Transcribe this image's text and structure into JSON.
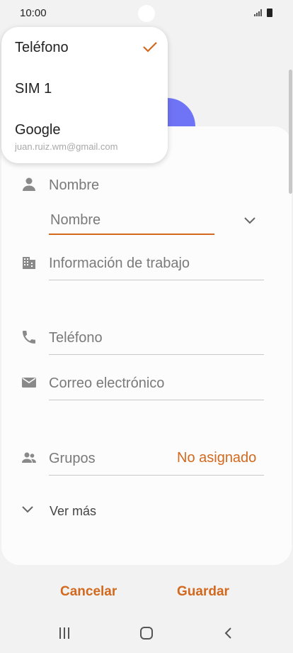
{
  "status_bar": {
    "time": "10:00"
  },
  "dropdown": {
    "items": [
      {
        "label": "Teléfono",
        "selected": true
      },
      {
        "label": "SIM 1"
      },
      {
        "label": "Google",
        "sub": "juan.ruiz.wm@gmail.com"
      }
    ]
  },
  "form": {
    "name_section_label": "Nombre",
    "name_field_placeholder": "Nombre",
    "work_label": "Información de trabajo",
    "phone_label": "Teléfono",
    "email_label": "Correo electrónico",
    "groups_label": "Grupos",
    "groups_value": "No asignado",
    "more_label": "Ver más"
  },
  "actions": {
    "cancel": "Cancelar",
    "save": "Guardar"
  },
  "colors": {
    "accent": "#d2691e",
    "avatar": "#6f73f5"
  },
  "icons": {
    "person": "person-icon",
    "work": "building-icon",
    "phone": "phone-icon",
    "email": "envelope-icon",
    "groups": "group-icon"
  }
}
